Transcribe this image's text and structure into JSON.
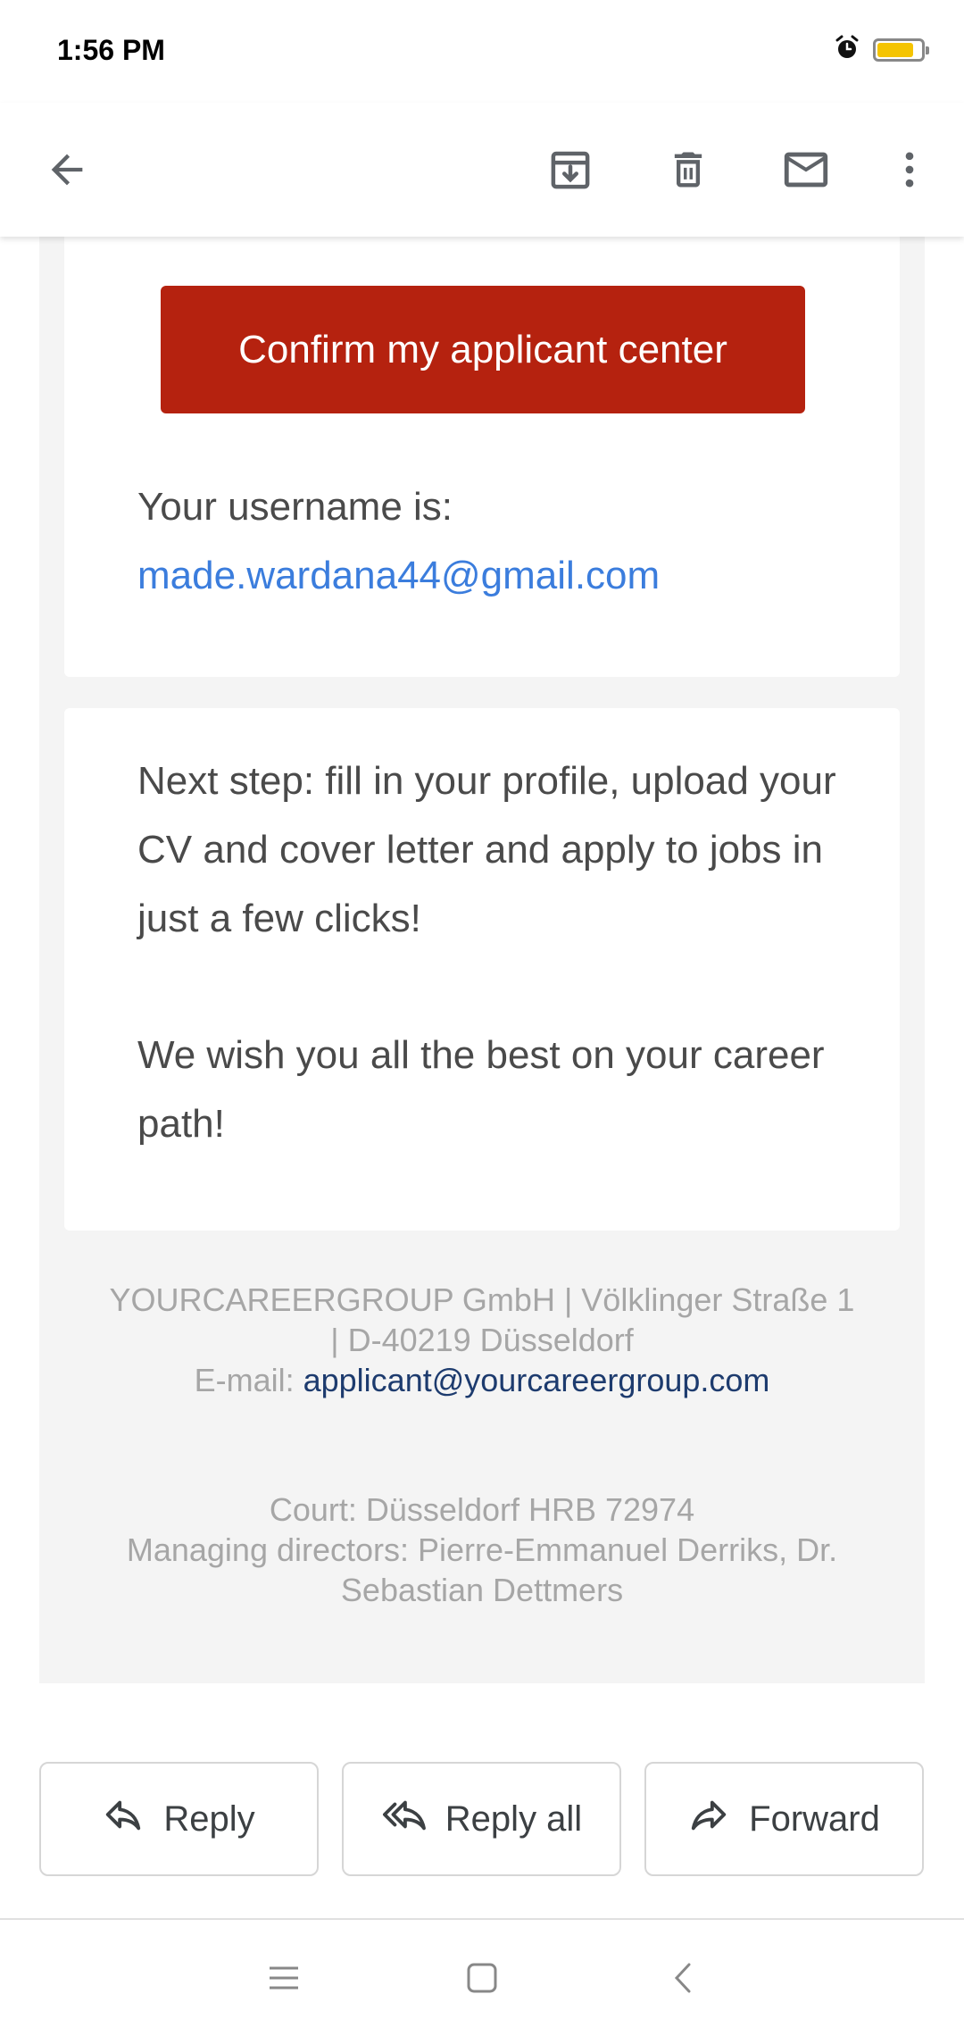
{
  "status": {
    "time": "1:56 PM",
    "battery_level": 0.85,
    "battery_color": "#f5c400"
  },
  "appbar": {
    "icons": [
      "back-arrow-icon",
      "archive-icon",
      "delete-icon",
      "mark-unread-icon",
      "more-vert-icon"
    ]
  },
  "email": {
    "cta_label": "Confirm my applicant center",
    "username_label": "Your username is:",
    "username": "made.wardana44@gmail.com",
    "next_step": "Next step: fill in your profile, upload your CV and cover letter and apply to jobs in just a few clicks!",
    "wish": "We wish you all the best on your career path!",
    "footer": {
      "company_line1": "YOURCAREERGROUP GmbH | Völklinger Straße 1",
      "company_line2": "| D-40219 Düsseldorf",
      "email_label": "E-mail:",
      "email": "applicant@yourcareergroup.com",
      "court": "Court: Düsseldorf HRB 72974",
      "directors_line1": "Managing directors: Pierre-Emmanuel Derriks, Dr.",
      "directors_line2": "Sebastian Dettmers"
    }
  },
  "actions": {
    "reply": "Reply",
    "reply_all": "Reply all",
    "forward": "Forward"
  },
  "colors": {
    "cta": "#b5220f",
    "link": "#3b7ddd",
    "footer_link": "#1d3b6e",
    "footer_text": "#a6a6a6"
  }
}
